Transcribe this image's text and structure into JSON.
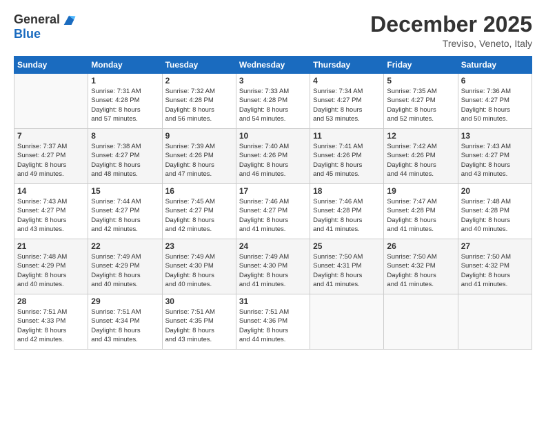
{
  "header": {
    "logo_general": "General",
    "logo_blue": "Blue",
    "month_title": "December 2025",
    "location": "Treviso, Veneto, Italy"
  },
  "days_of_week": [
    "Sunday",
    "Monday",
    "Tuesday",
    "Wednesday",
    "Thursday",
    "Friday",
    "Saturday"
  ],
  "weeks": [
    [
      {
        "day": "",
        "info": ""
      },
      {
        "day": "1",
        "info": "Sunrise: 7:31 AM\nSunset: 4:28 PM\nDaylight: 8 hours\nand 57 minutes."
      },
      {
        "day": "2",
        "info": "Sunrise: 7:32 AM\nSunset: 4:28 PM\nDaylight: 8 hours\nand 56 minutes."
      },
      {
        "day": "3",
        "info": "Sunrise: 7:33 AM\nSunset: 4:28 PM\nDaylight: 8 hours\nand 54 minutes."
      },
      {
        "day": "4",
        "info": "Sunrise: 7:34 AM\nSunset: 4:27 PM\nDaylight: 8 hours\nand 53 minutes."
      },
      {
        "day": "5",
        "info": "Sunrise: 7:35 AM\nSunset: 4:27 PM\nDaylight: 8 hours\nand 52 minutes."
      },
      {
        "day": "6",
        "info": "Sunrise: 7:36 AM\nSunset: 4:27 PM\nDaylight: 8 hours\nand 50 minutes."
      }
    ],
    [
      {
        "day": "7",
        "info": "Sunrise: 7:37 AM\nSunset: 4:27 PM\nDaylight: 8 hours\nand 49 minutes."
      },
      {
        "day": "8",
        "info": "Sunrise: 7:38 AM\nSunset: 4:27 PM\nDaylight: 8 hours\nand 48 minutes."
      },
      {
        "day": "9",
        "info": "Sunrise: 7:39 AM\nSunset: 4:26 PM\nDaylight: 8 hours\nand 47 minutes."
      },
      {
        "day": "10",
        "info": "Sunrise: 7:40 AM\nSunset: 4:26 PM\nDaylight: 8 hours\nand 46 minutes."
      },
      {
        "day": "11",
        "info": "Sunrise: 7:41 AM\nSunset: 4:26 PM\nDaylight: 8 hours\nand 45 minutes."
      },
      {
        "day": "12",
        "info": "Sunrise: 7:42 AM\nSunset: 4:26 PM\nDaylight: 8 hours\nand 44 minutes."
      },
      {
        "day": "13",
        "info": "Sunrise: 7:43 AM\nSunset: 4:27 PM\nDaylight: 8 hours\nand 43 minutes."
      }
    ],
    [
      {
        "day": "14",
        "info": "Sunrise: 7:43 AM\nSunset: 4:27 PM\nDaylight: 8 hours\nand 43 minutes."
      },
      {
        "day": "15",
        "info": "Sunrise: 7:44 AM\nSunset: 4:27 PM\nDaylight: 8 hours\nand 42 minutes."
      },
      {
        "day": "16",
        "info": "Sunrise: 7:45 AM\nSunset: 4:27 PM\nDaylight: 8 hours\nand 42 minutes."
      },
      {
        "day": "17",
        "info": "Sunrise: 7:46 AM\nSunset: 4:27 PM\nDaylight: 8 hours\nand 41 minutes."
      },
      {
        "day": "18",
        "info": "Sunrise: 7:46 AM\nSunset: 4:28 PM\nDaylight: 8 hours\nand 41 minutes."
      },
      {
        "day": "19",
        "info": "Sunrise: 7:47 AM\nSunset: 4:28 PM\nDaylight: 8 hours\nand 41 minutes."
      },
      {
        "day": "20",
        "info": "Sunrise: 7:48 AM\nSunset: 4:28 PM\nDaylight: 8 hours\nand 40 minutes."
      }
    ],
    [
      {
        "day": "21",
        "info": "Sunrise: 7:48 AM\nSunset: 4:29 PM\nDaylight: 8 hours\nand 40 minutes."
      },
      {
        "day": "22",
        "info": "Sunrise: 7:49 AM\nSunset: 4:29 PM\nDaylight: 8 hours\nand 40 minutes."
      },
      {
        "day": "23",
        "info": "Sunrise: 7:49 AM\nSunset: 4:30 PM\nDaylight: 8 hours\nand 40 minutes."
      },
      {
        "day": "24",
        "info": "Sunrise: 7:49 AM\nSunset: 4:30 PM\nDaylight: 8 hours\nand 41 minutes."
      },
      {
        "day": "25",
        "info": "Sunrise: 7:50 AM\nSunset: 4:31 PM\nDaylight: 8 hours\nand 41 minutes."
      },
      {
        "day": "26",
        "info": "Sunrise: 7:50 AM\nSunset: 4:32 PM\nDaylight: 8 hours\nand 41 minutes."
      },
      {
        "day": "27",
        "info": "Sunrise: 7:50 AM\nSunset: 4:32 PM\nDaylight: 8 hours\nand 41 minutes."
      }
    ],
    [
      {
        "day": "28",
        "info": "Sunrise: 7:51 AM\nSunset: 4:33 PM\nDaylight: 8 hours\nand 42 minutes."
      },
      {
        "day": "29",
        "info": "Sunrise: 7:51 AM\nSunset: 4:34 PM\nDaylight: 8 hours\nand 43 minutes."
      },
      {
        "day": "30",
        "info": "Sunrise: 7:51 AM\nSunset: 4:35 PM\nDaylight: 8 hours\nand 43 minutes."
      },
      {
        "day": "31",
        "info": "Sunrise: 7:51 AM\nSunset: 4:36 PM\nDaylight: 8 hours\nand 44 minutes."
      },
      {
        "day": "",
        "info": ""
      },
      {
        "day": "",
        "info": ""
      },
      {
        "day": "",
        "info": ""
      }
    ]
  ]
}
